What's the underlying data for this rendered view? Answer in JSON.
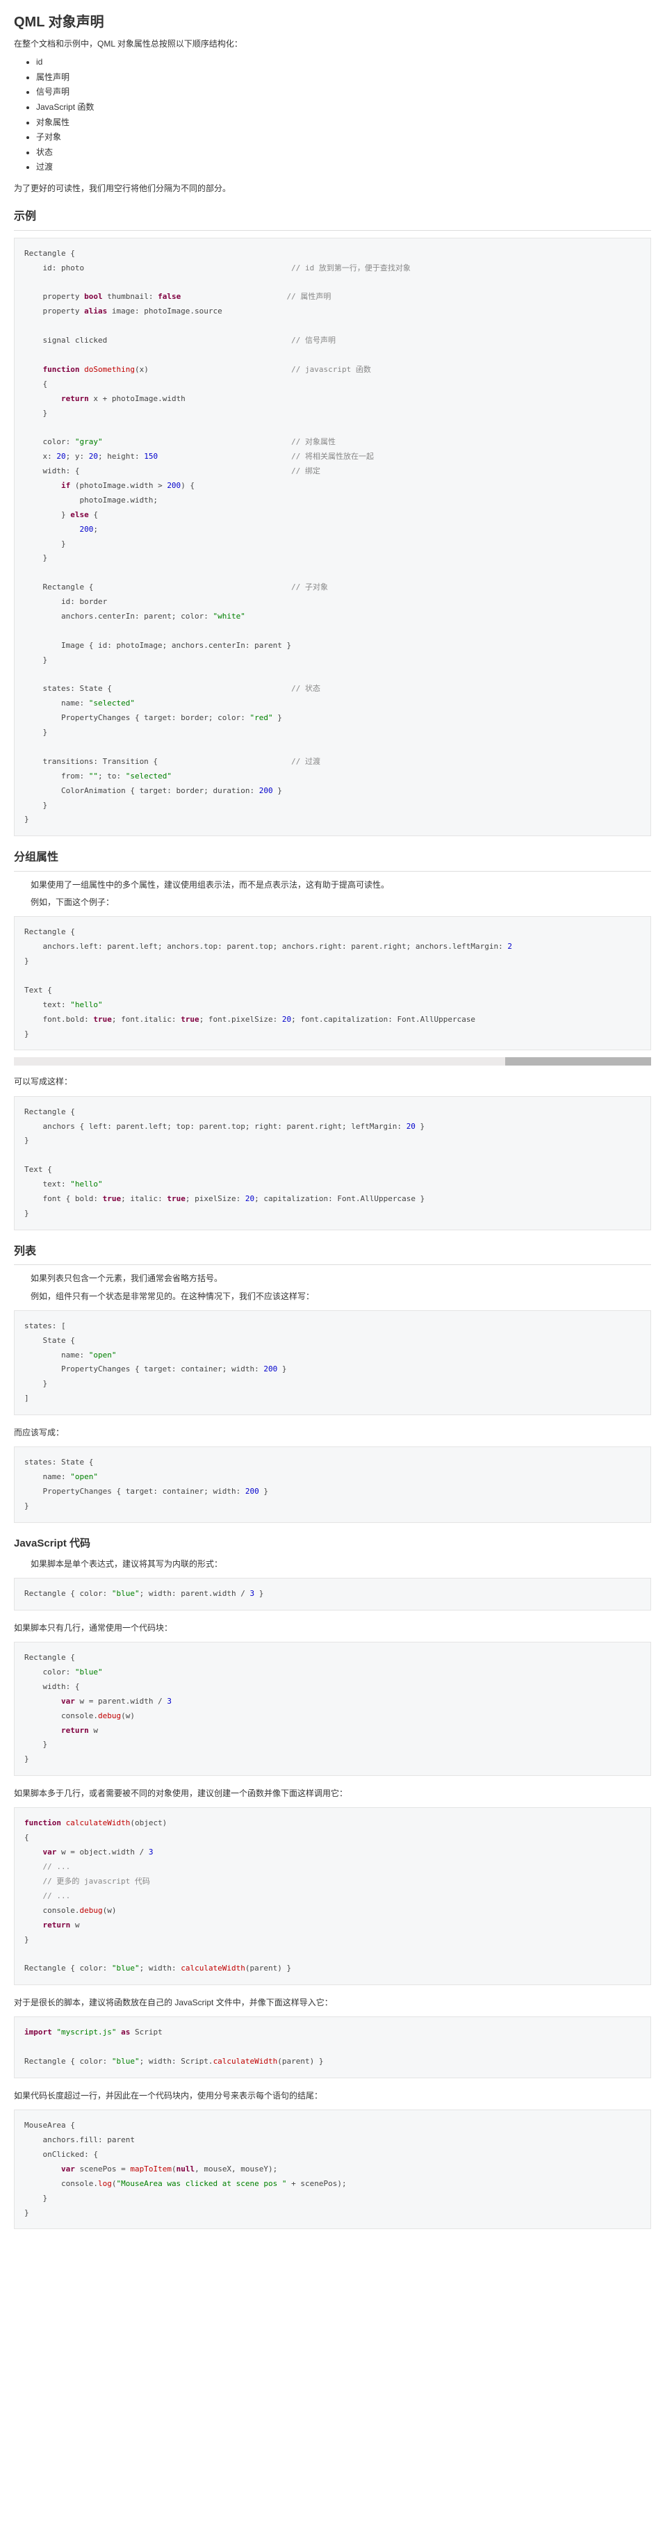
{
  "title": "QML 对象声明",
  "intro": "在整个文档和示例中，QML 对象属性总按照以下顺序结构化：",
  "order_list": [
    "id",
    "属性声明",
    "信号声明",
    "JavaScript 函数",
    "对象属性",
    "子对象",
    "状态",
    "过渡"
  ],
  "intro_after": "为了更好的可读性，我们用空行将他们分隔为不同的部分。",
  "section_example": "示例",
  "code_example_html": "Rectangle {\n    id: photo                                             <span class='cmt'>// id 放到第一行，便于查找对象</span>\n\n    property <span class='kw'>bool</span> thumbnail: <span class='kw'>false</span>                       <span class='cmt'>// 属性声明</span>\n    property <span class='kw'>alias</span> image: photoImage.source\n\n    signal clicked                                        <span class='cmt'>// 信号声明</span>\n\n    <span class='kw'>function</span> <span class='fn'>doSomething</span>(x)                               <span class='cmt'>// javascript 函数</span>\n    {\n        <span class='kw'>return</span> x + photoImage.width\n    }\n\n    color: <span class='str'>\"gray\"</span>                                         <span class='cmt'>// 对象属性</span>\n    x: <span class='num'>20</span>; y: <span class='num'>20</span>; height: <span class='num'>150</span>                             <span class='cmt'>// 将相关属性放在一起</span>\n    width: {                                              <span class='cmt'>// 绑定</span>\n        <span class='kw'>if</span> (photoImage.width &gt; <span class='num'>200</span>) {\n            photoImage.width;\n        } <span class='kw'>else</span> {\n            <span class='num'>200</span>;\n        }\n    }\n\n    Rectangle {                                           <span class='cmt'>// 子对象</span>\n        id: border\n        anchors.centerIn: parent; color: <span class='str'>\"white\"</span>\n\n        Image { id: photoImage; anchors.centerIn: parent }\n    }\n\n    states: State {                                       <span class='cmt'>// 状态</span>\n        name: <span class='str'>\"selected\"</span>\n        PropertyChanges { target: border; color: <span class='str'>\"red\"</span> }\n    }\n\n    transitions: Transition {                             <span class='cmt'>// 过渡</span>\n        from: <span class='str'>\"\"</span>; to: <span class='str'>\"selected\"</span>\n        ColorAnimation { target: border; duration: <span class='num'>200</span> }\n    }\n}",
  "section_group": "分组属性",
  "group_p1": "如果使用了一组属性中的多个属性，建议使用组表示法，而不是点表示法，这有助于提高可读性。",
  "group_p2": "例如，下面这个例子：",
  "code_group1_html": "Rectangle {\n    anchors.left: parent.left; anchors.top: parent.top; anchors.right: parent.right; anchors.leftMargin: <span class='num'>2</span>\n}\n\nText {\n    text: <span class='str'>\"hello\"</span>\n    font.bold: <span class='kw'>true</span>; font.italic: <span class='kw'>true</span>; font.pixelSize: <span class='num'>20</span>; font.capitalization: Font.AllUppercase\n}",
  "group_p3": "可以写成这样：",
  "code_group2_html": "Rectangle {\n    anchors { left: parent.left; top: parent.top; right: parent.right; leftMargin: <span class='num'>20</span> }\n}\n\nText {\n    text: <span class='str'>\"hello\"</span>\n    font { bold: <span class='kw'>true</span>; italic: <span class='kw'>true</span>; pixelSize: <span class='num'>20</span>; capitalization: Font.AllUppercase }\n}",
  "section_list": "列表",
  "list_p1": "如果列表只包含一个元素，我们通常会省略方括号。",
  "list_p2": "例如，组件只有一个状态是非常常见的。在这种情况下，我们不应该这样写：",
  "code_list1_html": "states: [\n    State {\n        name: <span class='str'>\"open\"</span>\n        PropertyChanges { target: container; width: <span class='num'>200</span> }\n    }\n]",
  "list_p3": "而应该写成：",
  "code_list2_html": "states: State {\n    name: <span class='str'>\"open\"</span>\n    PropertyChanges { target: container; width: <span class='num'>200</span> }\n}",
  "section_js": "JavaScript 代码",
  "js_p1": "如果脚本是单个表达式，建议将其写为内联的形式：",
  "code_js1_html": "Rectangle { color: <span class='str'>\"blue\"</span>; width: parent.width / <span class='num'>3</span> }",
  "js_p2": "如果脚本只有几行，通常使用一个代码块：",
  "code_js2_html": "Rectangle {\n    color: <span class='str'>\"blue\"</span>\n    width: {\n        <span class='kw'>var</span> w = parent.width / <span class='num'>3</span>\n        console.<span class='fn'>debug</span>(w)\n        <span class='kw'>return</span> w\n    }\n}",
  "js_p3": "如果脚本多于几行，或者需要被不同的对象使用，建议创建一个函数并像下面这样调用它：",
  "code_js3_html": "<span class='kw'>function</span> <span class='fn'>calculateWidth</span>(object)\n{\n    <span class='kw'>var</span> w = object.width / <span class='num'>3</span>\n    <span class='cmt'>// ...</span>\n    <span class='cmt'>// 更多的 javascript 代码</span>\n    <span class='cmt'>// ...</span>\n    console.<span class='fn'>debug</span>(w)\n    <span class='kw'>return</span> w\n}\n\nRectangle { color: <span class='str'>\"blue\"</span>; width: <span class='fn'>calculateWidth</span>(parent) }",
  "js_p4": "对于是很长的脚本，建议将函数放在自己的 JavaScript 文件中，并像下面这样导入它：",
  "code_js4_html": "<span class='kw'>import</span> <span class='str'>\"myscript.js\"</span> <span class='kw'>as</span> Script\n\nRectangle { color: <span class='str'>\"blue\"</span>; width: Script.<span class='fn'>calculateWidth</span>(parent) }",
  "js_p5": "如果代码长度超过一行，并因此在一个代码块内，使用分号来表示每个语句的结尾：",
  "code_js5_html": "MouseArea {\n    anchors.fill: parent\n    onClicked: {\n        <span class='kw'>var</span> scenePos = <span class='fn'>mapToItem</span>(<span class='kw'>null</span>, mouseX, mouseY);\n        console.<span class='fn'>log</span>(<span class='str'>\"MouseArea was clicked at scene pos \"</span> + scenePos);\n    }\n}"
}
